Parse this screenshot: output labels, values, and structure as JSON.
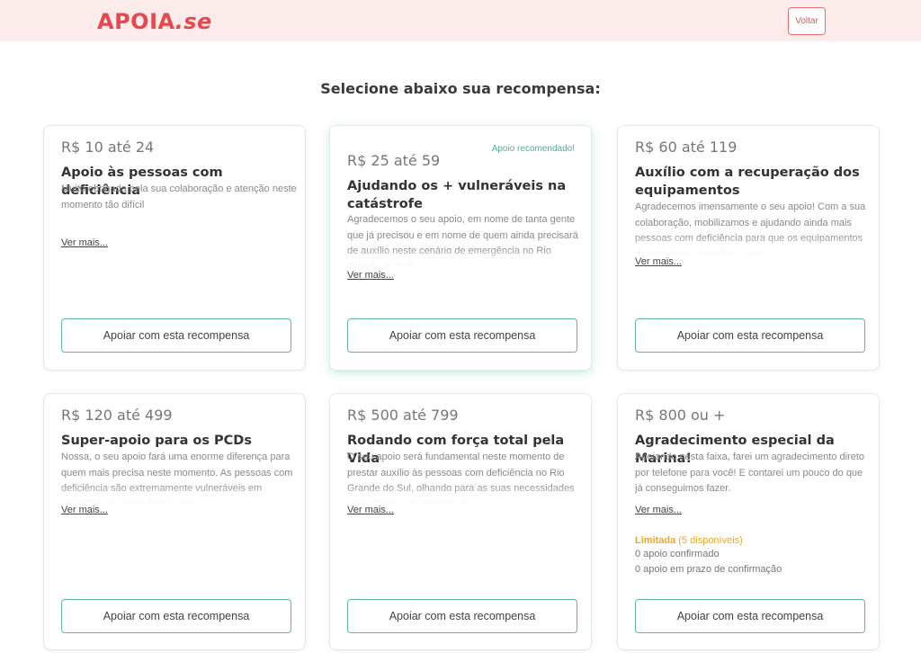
{
  "header": {
    "logo_main": "APOIA",
    "logo_suffix": ".se",
    "back_label": "Voltar"
  },
  "page": {
    "title": "Selecione abaixo sua recompensa:"
  },
  "rewards": [
    {
      "price": "R$ 10 até 24",
      "title": "Apoio às pessoas com deficiência",
      "description": "Muito obrigada pela sua colaboração e atenção neste momento tão difícil",
      "more": "Ver mais...",
      "button": "Apoiar com esta recompensa"
    },
    {
      "badge": "Apoio recomendado!",
      "price": "R$ 25 até 59",
      "title": "Ajudando os + vulneráveis na catástrofe",
      "description": "Agradecemos o seu apoio, em nome de tanta gente que já precisou e em nome de quem ainda precisará de auxílio neste cenário de emergência no Rio Grande do Sul!",
      "more": "Ver mais...",
      "button": "Apoiar com esta recompensa"
    },
    {
      "price": "R$ 60 até 119",
      "title": "Auxílio com a recuperação dos equipamentos",
      "description": "Agradecemos imensamente o seu apoio! Com a sua colaboração, mobilizamos e ajudando ainda mais pessoas com deficiência para que os equipamentos de tecnologia assistiva sejam",
      "more": "Ver mais...",
      "button": "Apoiar com esta recompensa"
    },
    {
      "price": "R$ 120 até 499",
      "title": "Super-apoio para os PCDs",
      "description": "Nossa, o seu apoio fará uma enorme diferença para quem mais precisa neste momento. As pessoas com deficiência são extremamente vulneráveis em situações de emergência como",
      "more": "Ver mais...",
      "button": "Apoiar com esta recompensa"
    },
    {
      "price": "R$ 500 até 799",
      "title": "Rodando com força total pela Vida",
      "description": "O seu apoio será fundamental neste momento de prestar auxílio às pessoas com deficiência no Rio Grande do Sul, olhando para as suas necessidades específicas e garantindo que",
      "more": "Ver mais...",
      "button": "Apoiar com esta recompensa"
    },
    {
      "price": "R$ 800 ou +",
      "title": "Agradecimento especial da Marina!",
      "description": "Apoiando nesta faixa, farei um agradecimento direto por telefone para você! E contarei um pouco do que já conseguimos fazer.",
      "more": "Ver mais...",
      "limit_label": "Limitada",
      "limit_available": "(5 disponíveis)",
      "confirmed": "0 apoio confirmado",
      "pending": "0 apoio em prazo de confirmação",
      "button": "Apoiar com esta recompensa"
    }
  ],
  "colors": {
    "brand": "#e5484d",
    "accent_green": "#5cb99a",
    "limited_orange": "#e8a82a",
    "header_bg": "#fbeceb"
  }
}
